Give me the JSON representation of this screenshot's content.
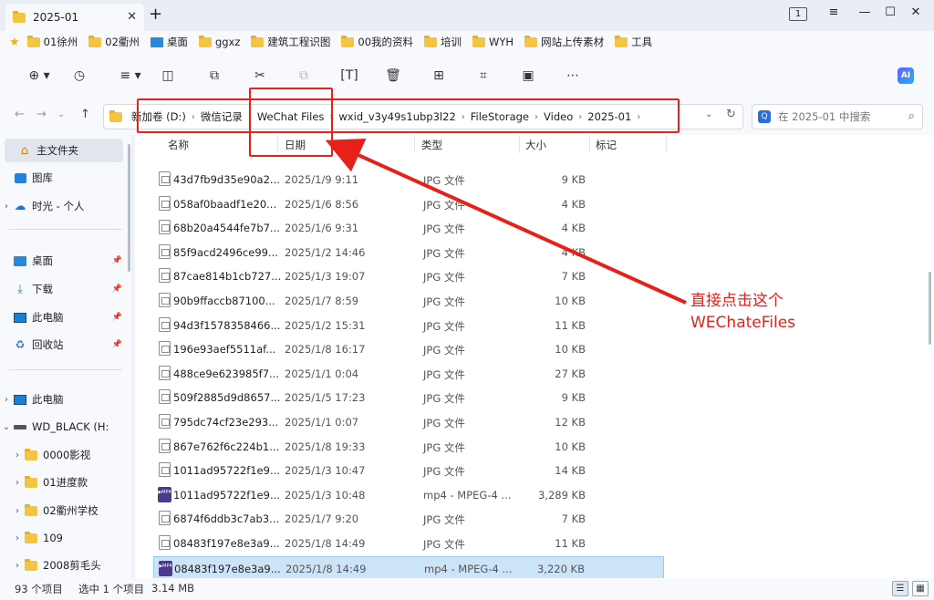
{
  "window": {
    "tab_title": "2025-01",
    "tab_count": "1"
  },
  "bookmarks": [
    {
      "label": "01徐州",
      "icon": "folder-icon"
    },
    {
      "label": "02衢州",
      "icon": "folder-icon"
    },
    {
      "label": "桌面",
      "icon": "desktop-icon"
    },
    {
      "label": "ggxz",
      "icon": "folder-icon"
    },
    {
      "label": "建筑工程识图",
      "icon": "folder-icon"
    },
    {
      "label": "00我的资料",
      "icon": "folder-icon"
    },
    {
      "label": "培训",
      "icon": "folder-icon"
    },
    {
      "label": "WYH",
      "icon": "folder-icon"
    },
    {
      "label": "网站上传素材",
      "icon": "folder-icon"
    },
    {
      "label": "工具",
      "icon": "folder-icon"
    }
  ],
  "toolbar": {
    "ai_label": "AI"
  },
  "address": {
    "crumbs": [
      "新加卷 (D:)",
      "微信记录",
      "WeChat Files",
      "wxid_v3y49s1ubp3l22",
      "FileStorage",
      "Video",
      "2025-01"
    ],
    "search_placeholder": "在 2025-01 中搜索"
  },
  "sidebar": {
    "items": [
      {
        "label": "主文件夹",
        "icon": "home-icon"
      },
      {
        "label": "图库",
        "icon": "gallery-icon"
      },
      {
        "label": "时光 - 个人",
        "icon": "cloud-icon"
      },
      {
        "label": "桌面",
        "icon": "desktop-icon"
      },
      {
        "label": "下载",
        "icon": "download-icon"
      },
      {
        "label": "此电脑",
        "icon": "computer-icon"
      },
      {
        "label": "回收站",
        "icon": "recycle-bin-icon"
      },
      {
        "label": "此电脑",
        "icon": "computer-icon"
      },
      {
        "label": "WD_BLACK (H:",
        "icon": "drive-icon"
      },
      {
        "label": "0000影视",
        "icon": "folder-icon"
      },
      {
        "label": "01进度款",
        "icon": "folder-icon"
      },
      {
        "label": "02衢州学校",
        "icon": "folder-icon"
      },
      {
        "label": "109",
        "icon": "folder-icon"
      },
      {
        "label": "2008剪毛头",
        "icon": "folder-icon"
      }
    ]
  },
  "columns": {
    "name": "名称",
    "date": "日期",
    "type": "类型",
    "size": "大小",
    "tags": "标记"
  },
  "files": [
    {
      "name": "43d7fb9d35e90a2...",
      "date": "2025/1/9 9:11",
      "type": "JPG 文件",
      "size": "9 KB"
    },
    {
      "name": "058af0baadf1e20...",
      "date": "2025/1/6 8:56",
      "type": "JPG 文件",
      "size": "4 KB"
    },
    {
      "name": "68b20a4544fe7b7...",
      "date": "2025/1/6 9:31",
      "type": "JPG 文件",
      "size": "4 KB"
    },
    {
      "name": "85f9acd2496ce99...",
      "date": "2025/1/2 14:46",
      "type": "JPG 文件",
      "size": "4 KB"
    },
    {
      "name": "87cae814b1cb727...",
      "date": "2025/1/3 19:07",
      "type": "JPG 文件",
      "size": "7 KB"
    },
    {
      "name": "90b9ffaccb87100...",
      "date": "2025/1/7 8:59",
      "type": "JPG 文件",
      "size": "10 KB"
    },
    {
      "name": "94d3f1578358466...",
      "date": "2025/1/2 15:31",
      "type": "JPG 文件",
      "size": "11 KB"
    },
    {
      "name": "196e93aef5511af...",
      "date": "2025/1/8 16:17",
      "type": "JPG 文件",
      "size": "10 KB"
    },
    {
      "name": "488ce9e623985f7...",
      "date": "2025/1/1 0:04",
      "type": "JPG 文件",
      "size": "27 KB"
    },
    {
      "name": "509f2885d9d8657...",
      "date": "2025/1/5 17:23",
      "type": "JPG 文件",
      "size": "9 KB"
    },
    {
      "name": "795dc74cf23e293...",
      "date": "2025/1/1 0:07",
      "type": "JPG 文件",
      "size": "12 KB"
    },
    {
      "name": "867e762f6c224b1...",
      "date": "2025/1/8 19:33",
      "type": "JPG 文件",
      "size": "10 KB"
    },
    {
      "name": "1011ad95722f1e9...",
      "date": "2025/1/3 10:47",
      "type": "JPG 文件",
      "size": "14 KB"
    },
    {
      "name": "1011ad95722f1e9...",
      "date": "2025/1/3 10:48",
      "type": "mp4 - MPEG-4 ...",
      "size": "3,289 KB",
      "video": true
    },
    {
      "name": "6874f6ddb3c7ab3...",
      "date": "2025/1/7 9:20",
      "type": "JPG 文件",
      "size": "7 KB"
    },
    {
      "name": "08483f197e8e3a9...",
      "date": "2025/1/8 14:49",
      "type": "JPG 文件",
      "size": "11 KB"
    },
    {
      "name": "08483f197e8e3a9...",
      "date": "2025/1/8 14:49",
      "type": "mp4 - MPEG-4 ...",
      "size": "3,220 KB",
      "video": true,
      "selected": true
    }
  ],
  "status": {
    "count": "93 个项目",
    "selected": "选中 1 个项目",
    "size": "3.14 MB"
  },
  "annotation": {
    "line1": "直接点击这个",
    "line2": "WEChateFiles",
    "color": "#e8201a"
  }
}
